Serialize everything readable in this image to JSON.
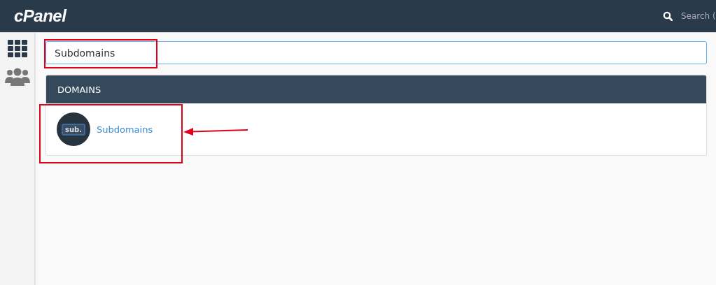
{
  "header": {
    "logo": "cPanel",
    "search_placeholder": "Search ("
  },
  "search": {
    "value": "Subdomains"
  },
  "sidebar": {
    "items": [
      {
        "kind": "grid",
        "selected": true
      },
      {
        "kind": "users",
        "selected": false
      }
    ]
  },
  "panel": {
    "title": "DOMAINS",
    "items": [
      {
        "icon_text": "sub.",
        "label": "Subdomains"
      }
    ]
  }
}
